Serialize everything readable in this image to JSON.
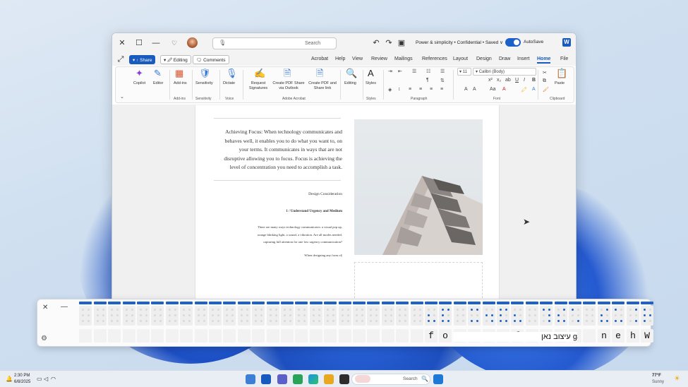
{
  "window": {
    "title": "Power & simplicity • Confidential • Saved ∨",
    "autosave_label": "AutoSave",
    "search_placeholder": "Search",
    "app_letter": "W"
  },
  "menu": {
    "tabs": [
      "File",
      "Home",
      "Insert",
      "Draw",
      "Design",
      "Layout",
      "References",
      "Mailings",
      "Review",
      "View",
      "Help",
      "Acrobat"
    ],
    "active_tab": "Home",
    "comments_label": "Comments",
    "editing_label": "Editing",
    "share_label": "Share"
  },
  "ribbon": {
    "paste_label": "Paste",
    "clipboard_label": "Clipboard",
    "font_name": "Calibri (Body)",
    "font_size": "11",
    "font_group_label": "Font",
    "paragraph_group_label": "Paragraph",
    "styles_label": "Styles",
    "styles_group_label": "Styles",
    "editing_label": "Editing",
    "acrobat_btn1": "Create PDF and Share link",
    "acrobat_btn2": "Create PDF Share via Outlook",
    "acrobat_btn3": "Request Signatures",
    "acrobat_group_label": "Adobe Acrobat",
    "dictate_label": "Dictate",
    "voice_group_label": "Voice",
    "sensitivity_label": "Sensitivity",
    "sensitivity_group_label": "Sensitivity",
    "addins_label": "Add-ins",
    "addins_group_label": "Add-ins",
    "editor_label": "Editor",
    "copilot_label": "Copilot"
  },
  "document": {
    "paragraph_lines": [
      "Achieving Focus: When technology communicates and",
      "behaves well, it enables you to do what you want to, on",
      "your terms. It communicates in ways that are not",
      "disruptive allowing you to focus. Focus is achieving the",
      "level of concentration you need to accomplish a task."
    ],
    "section_heading": "Design Consideration",
    "subheading": "1 / Understand Urgency and Medium",
    "body_lines": [
      "There are many ways technology communicates: a visual pop up,",
      "orange blinking light, a sound, a vibration. Are all modes needed,",
      "capturing full attention for one low urgency communication?"
    ],
    "trailing_line": "When designing any form of|"
  },
  "braille": {
    "chars": [
      "W",
      "h",
      "e",
      "n",
      "",
      "a",
      "n",
      "y",
      "",
      "f",
      "o",
      "r",
      "m",
      "",
      "o",
      "f",
      "",
      "",
      "",
      "",
      "",
      "",
      "",
      "",
      "",
      "",
      "",
      "",
      "",
      "",
      "",
      "",
      "",
      "",
      "",
      "",
      "",
      "",
      "",
      "",
      "",
      "",
      ""
    ],
    "hebrew_text": "עיצוב נאן g"
  },
  "taskbar": {
    "search_placeholder": "Search",
    "weather_temp": "77°F",
    "weather_desc": "Sunny",
    "time": "2:30 PM",
    "date": "6/8/2025"
  }
}
